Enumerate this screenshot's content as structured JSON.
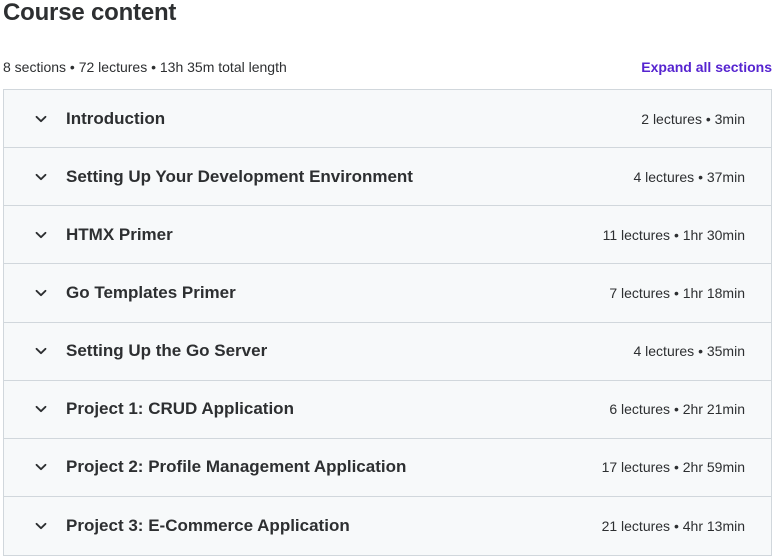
{
  "header": {
    "title": "Course content",
    "summary": "8 sections • 72 lectures • 13h 35m total length",
    "expand_all": "Expand all sections"
  },
  "colors": {
    "accent": "#5624d0",
    "section_bg": "#f7f9fa",
    "border": "#d1d7dc",
    "text": "#2d2f31"
  },
  "sections": [
    {
      "title": "Introduction",
      "meta": "2 lectures • 3min",
      "icon": "chevron-down-icon"
    },
    {
      "title": "Setting Up Your Development Environment",
      "meta": "4 lectures • 37min",
      "icon": "chevron-down-icon"
    },
    {
      "title": "HTMX Primer",
      "meta": "11 lectures • 1hr 30min",
      "icon": "chevron-down-icon"
    },
    {
      "title": "Go Templates Primer",
      "meta": "7 lectures • 1hr 18min",
      "icon": "chevron-down-icon"
    },
    {
      "title": "Setting Up the Go Server",
      "meta": "4 lectures • 35min",
      "icon": "chevron-down-icon"
    },
    {
      "title": "Project 1: CRUD Application",
      "meta": "6 lectures • 2hr 21min",
      "icon": "chevron-down-icon"
    },
    {
      "title": "Project 2: Profile Management Application",
      "meta": "17 lectures • 2hr 59min",
      "icon": "chevron-down-icon"
    },
    {
      "title": "Project 3: E-Commerce Application",
      "meta": "21 lectures • 4hr 13min",
      "icon": "chevron-down-icon"
    }
  ]
}
